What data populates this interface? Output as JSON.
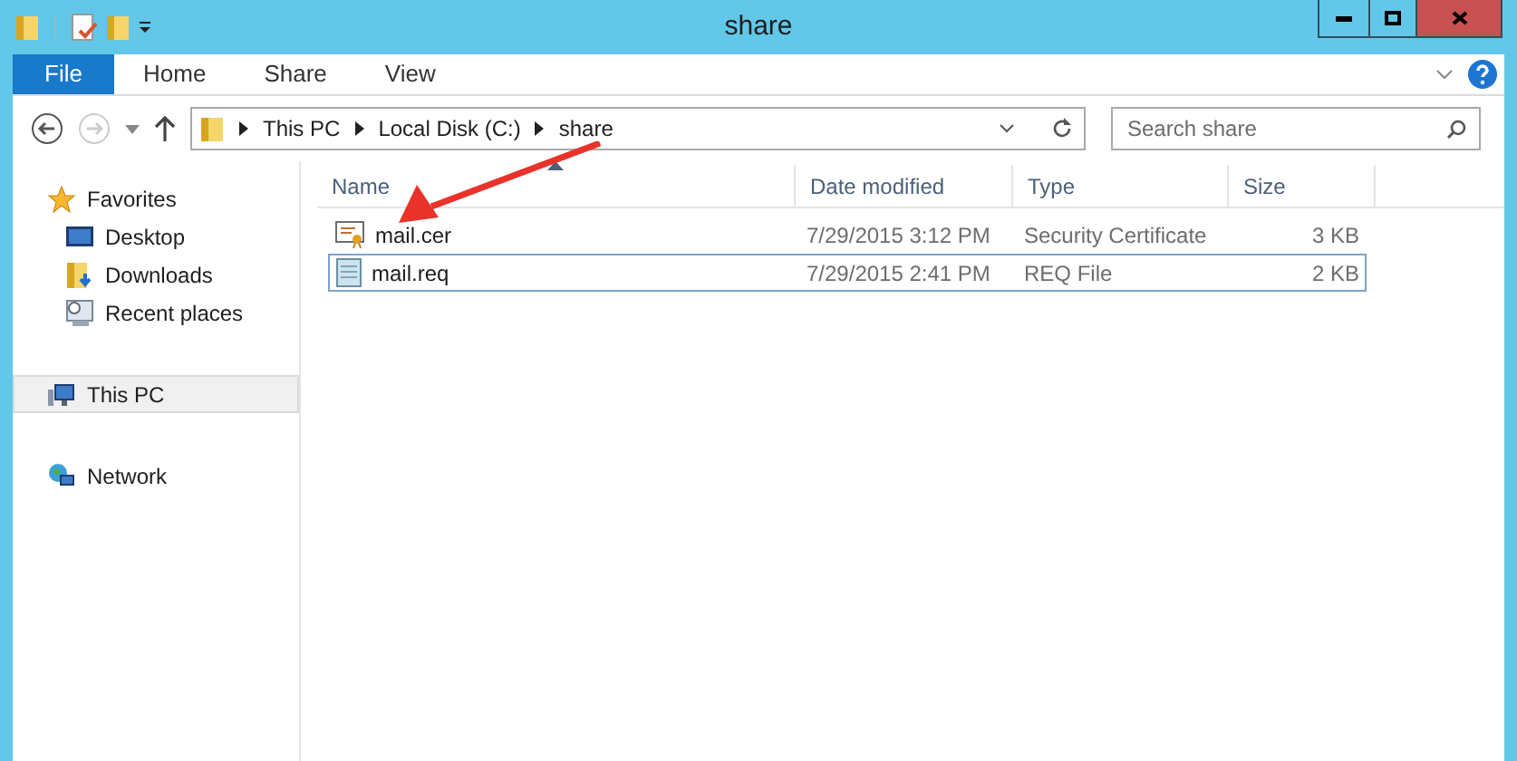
{
  "window": {
    "title": "share"
  },
  "ribbon_tabs": [
    {
      "label": "File",
      "selected": true
    },
    {
      "label": "Home",
      "selected": false
    },
    {
      "label": "Share",
      "selected": false
    },
    {
      "label": "View",
      "selected": false
    }
  ],
  "address": {
    "crumbs": [
      "This PC",
      "Local Disk (C:)",
      "share"
    ]
  },
  "search": {
    "placeholder": "Search share"
  },
  "sidebar": {
    "groups": [
      {
        "label": "Favorites",
        "kind": "favorites",
        "selected": false,
        "children": [
          {
            "label": "Desktop",
            "kind": "desktop"
          },
          {
            "label": "Downloads",
            "kind": "downloads"
          },
          {
            "label": "Recent places",
            "kind": "recent"
          }
        ]
      },
      {
        "label": "This PC",
        "kind": "pc",
        "selected": true
      },
      {
        "label": "Network",
        "kind": "network",
        "selected": false
      }
    ]
  },
  "table": {
    "columns": [
      "Name",
      "Date modified",
      "Type",
      "Size"
    ],
    "rows": [
      {
        "name": "mail.cer",
        "date": "7/29/2015 3:12 PM",
        "type": "Security Certificate",
        "size": "3 KB",
        "kind": "certificate",
        "selected": false
      },
      {
        "name": "mail.req",
        "date": "7/29/2015 2:41 PM",
        "type": "REQ File",
        "size": "2 KB",
        "kind": "text",
        "selected": true
      }
    ]
  }
}
